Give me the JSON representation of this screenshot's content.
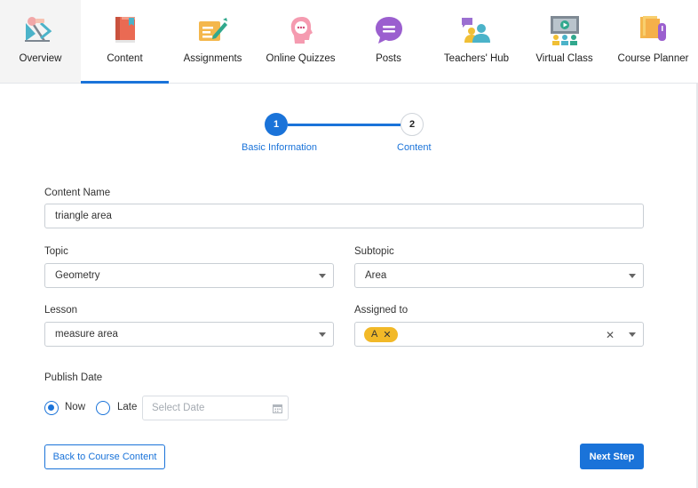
{
  "nav": {
    "items": [
      {
        "label": "Overview",
        "icon": "overview-icon"
      },
      {
        "label": "Content",
        "icon": "book-icon"
      },
      {
        "label": "Assignments",
        "icon": "assignment-pencil-icon"
      },
      {
        "label": "Online Quizzes",
        "icon": "quiz-head-icon"
      },
      {
        "label": "Posts",
        "icon": "chat-bubble-icon"
      },
      {
        "label": "Teachers' Hub",
        "icon": "teachers-group-icon"
      },
      {
        "label": "Virtual Class",
        "icon": "virtual-class-icon"
      },
      {
        "label": "Course Planner",
        "icon": "planner-icon"
      }
    ],
    "active": "Content",
    "accent_color": "#1a73d9"
  },
  "stepper": {
    "steps": [
      {
        "number": "1",
        "label": "Basic Information",
        "state": "active"
      },
      {
        "number": "2",
        "label": "Content",
        "state": "pending"
      }
    ]
  },
  "form": {
    "content_name": {
      "label": "Content Name",
      "value": "triangle area"
    },
    "topic": {
      "label": "Topic",
      "value": "Geometry"
    },
    "subtopic": {
      "label": "Subtopic",
      "value": "Area"
    },
    "lesson": {
      "label": "Lesson",
      "value": "measure area"
    },
    "assigned_to": {
      "label": "Assigned to",
      "chips": [
        "A"
      ],
      "chip_color": "#f2b928"
    },
    "publish_date": {
      "label": "Publish Date",
      "options": [
        {
          "label": "Now",
          "selected": true
        },
        {
          "label": "Late",
          "selected": false
        }
      ],
      "date_placeholder": "Select Date"
    }
  },
  "actions": {
    "back_label": "Back to Course Content",
    "next_label": "Next Step"
  }
}
